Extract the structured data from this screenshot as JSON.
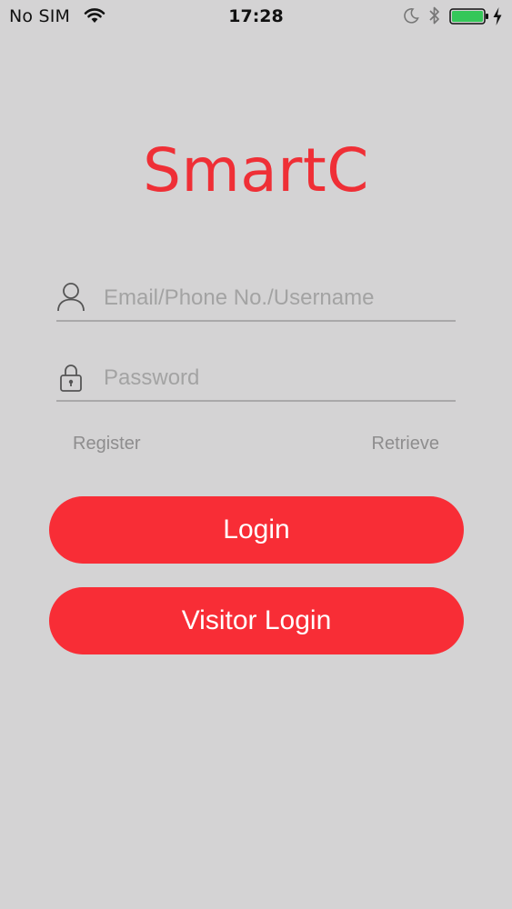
{
  "status_bar": {
    "carrier": "No SIM",
    "time": "17:28",
    "icons": [
      "wifi-icon",
      "moon-icon",
      "bluetooth-icon",
      "battery-icon",
      "charge-icon"
    ],
    "battery_level": 1.0,
    "battery_color": "#35c759"
  },
  "app": {
    "logo_text": "SmartC",
    "brand_color": "#ef2f36",
    "background_color": "#d4d3d4"
  },
  "form": {
    "username": {
      "icon": "user-icon",
      "placeholder": "Email/Phone No./Username",
      "value": ""
    },
    "password": {
      "icon": "lock-icon",
      "placeholder": "Password",
      "value": ""
    }
  },
  "links": {
    "register": "Register",
    "retrieve": "Retrieve"
  },
  "buttons": {
    "login": "Login",
    "visitor_login": "Visitor Login",
    "color": "#f82d36"
  }
}
